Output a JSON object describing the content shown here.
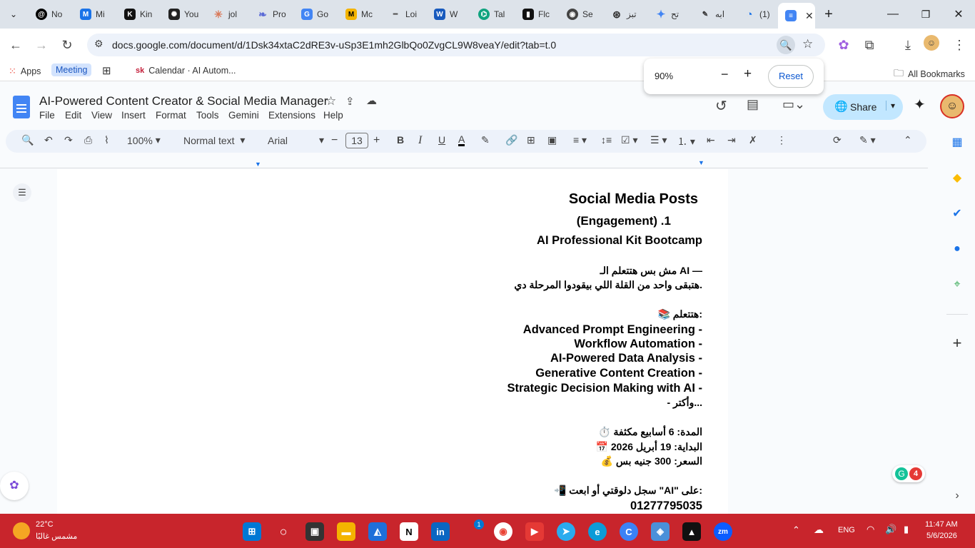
{
  "browser": {
    "tabs": [
      {
        "label": "No",
        "icon": "threads-icon"
      },
      {
        "label": "Mi",
        "icon": "medium-icon"
      },
      {
        "label": "Kin",
        "icon": "k-icon"
      },
      {
        "label": "You",
        "icon": "openai-icon"
      },
      {
        "label": "jol",
        "icon": "claude-icon"
      },
      {
        "label": "Pro",
        "icon": "app-icon"
      },
      {
        "label": "Go",
        "icon": "google-icon"
      },
      {
        "label": "Mc",
        "icon": "m-icon"
      },
      {
        "label": "Loi",
        "icon": "line-icon"
      },
      {
        "label": "W",
        "icon": "word-icon"
      },
      {
        "label": "Tal",
        "icon": "chatgpt-icon"
      },
      {
        "label": "Flc",
        "icon": "flow-icon"
      },
      {
        "label": "Se",
        "icon": "search-tab-icon"
      },
      {
        "label": "تبز",
        "icon": "openai-icon"
      },
      {
        "label": "تح",
        "icon": "gemini-icon"
      },
      {
        "label": "ابه",
        "icon": "tool-icon"
      },
      {
        "label": "(1)",
        "icon": "swirl-icon"
      }
    ],
    "url": "docs.google.com/document/d/1Dsk34xtaC2dRE3v-uSp3E1mh2GlbQo0ZvgCL9W8veaY/edit?tab=t.0",
    "bookmarks": {
      "apps": "Apps",
      "meeting": "Meeting",
      "calendar": "Calendar · AI Autom...",
      "all": "All Bookmarks"
    },
    "zoom": {
      "value": "90%",
      "reset": "Reset"
    }
  },
  "docs": {
    "title": "AI-Powered Content Creator & Social Media Manager",
    "menus": [
      "File",
      "Edit",
      "View",
      "Insert",
      "Format",
      "Tools",
      "Gemini",
      "Extensions",
      "Help"
    ],
    "share": "Share",
    "toolbar": {
      "zoom": "100%",
      "style": "Normal text",
      "font": "Arial",
      "size": "13"
    }
  },
  "document": {
    "lines": [
      "Social Media Posts",
      "(Engagement) .1",
      "AI Professional Kit Bootcamp",
      "مش بس هتتعلم الـ AI —",
      "هتبقى واحد من القلة اللي بيقودوا المرحلة دي.",
      "📚 هتتعلم:",
      "Advanced Prompt Engineering -",
      "Workflow Automation -",
      "AI-Powered Data Analysis -",
      "Generative Content Creation -",
      "Strategic Decision Making with AI -",
      "- وأكتر...",
      "⏱️ المدة: 6 أسابيع مكثفة",
      "📅 البداية: 19 أبريل 2026",
      "💰 السعر: 300 جنيه بس",
      "📲 سجل دلوقتي أو ابعت \"AI\" على:",
      "01277795035"
    ]
  },
  "badge": "4",
  "taskbar": {
    "temp": "22°C",
    "weather": "مشمس غالبًا",
    "lang": "ENG",
    "time": "11:47 AM",
    "date": "5/6/2026",
    "notif": "1"
  },
  "colors": {
    "taskbar": "#c8252c",
    "share": "#c2e7ff",
    "docs_blue": "#4285f4"
  }
}
